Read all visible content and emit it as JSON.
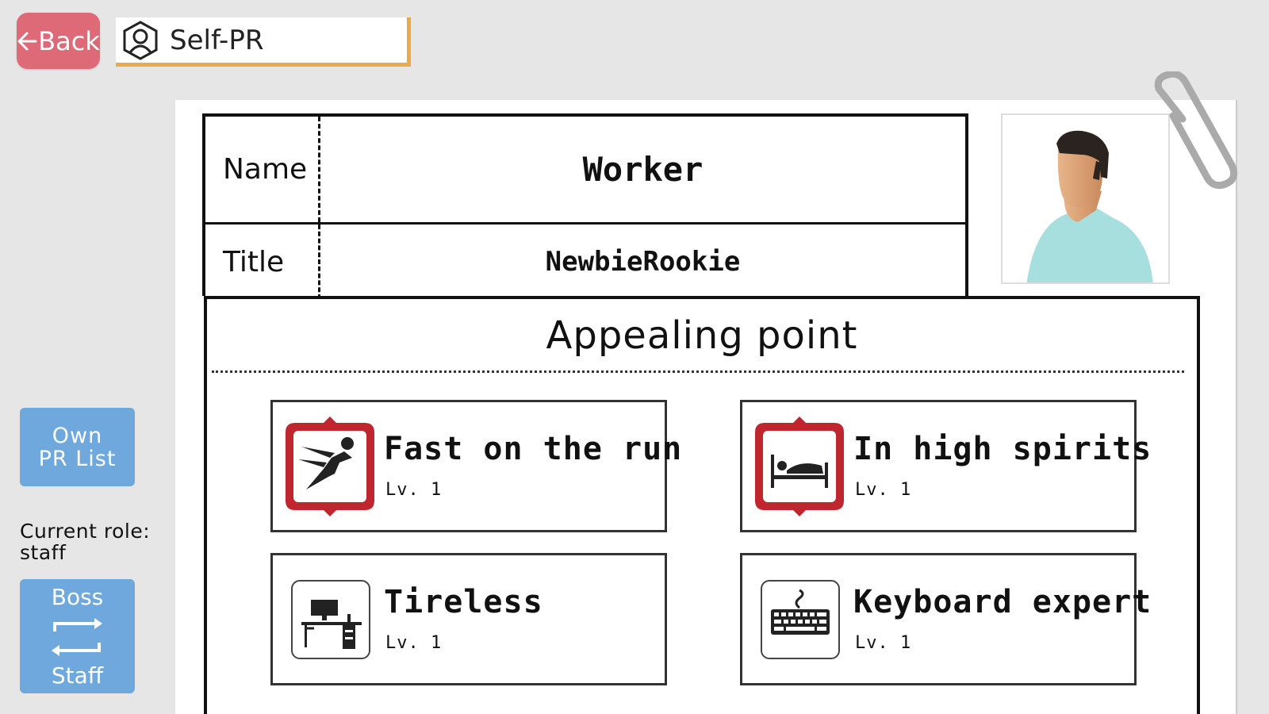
{
  "header": {
    "back_label": "Back",
    "title": "Self-PR"
  },
  "sidebar": {
    "own_pr_list_label": "Own PR List",
    "current_role_label": "Current role:",
    "current_role_value": "staff",
    "switch_top_label": "Boss",
    "switch_bottom_label": "Staff"
  },
  "profile": {
    "name_label": "Name",
    "name_value": "Worker",
    "title_label": "Title",
    "title_value": "NewbieRookie"
  },
  "appeal": {
    "heading": "Appealing point",
    "skills": [
      {
        "name": "Fast on the run",
        "level": "Lv. 1",
        "icon": "runner-icon"
      },
      {
        "name": "In high spirits",
        "level": "Lv. 1",
        "icon": "bed-icon"
      },
      {
        "name": "Tireless",
        "level": "Lv. 1",
        "icon": "desk-icon"
      },
      {
        "name": "Keyboard expert",
        "level": "Lv. 1",
        "icon": "keyboard-icon"
      }
    ]
  },
  "colors": {
    "back_button": "#de6a78",
    "title_accent": "#e9a94c",
    "side_button": "#6fa8dc",
    "badge_red": "#c0262e"
  }
}
